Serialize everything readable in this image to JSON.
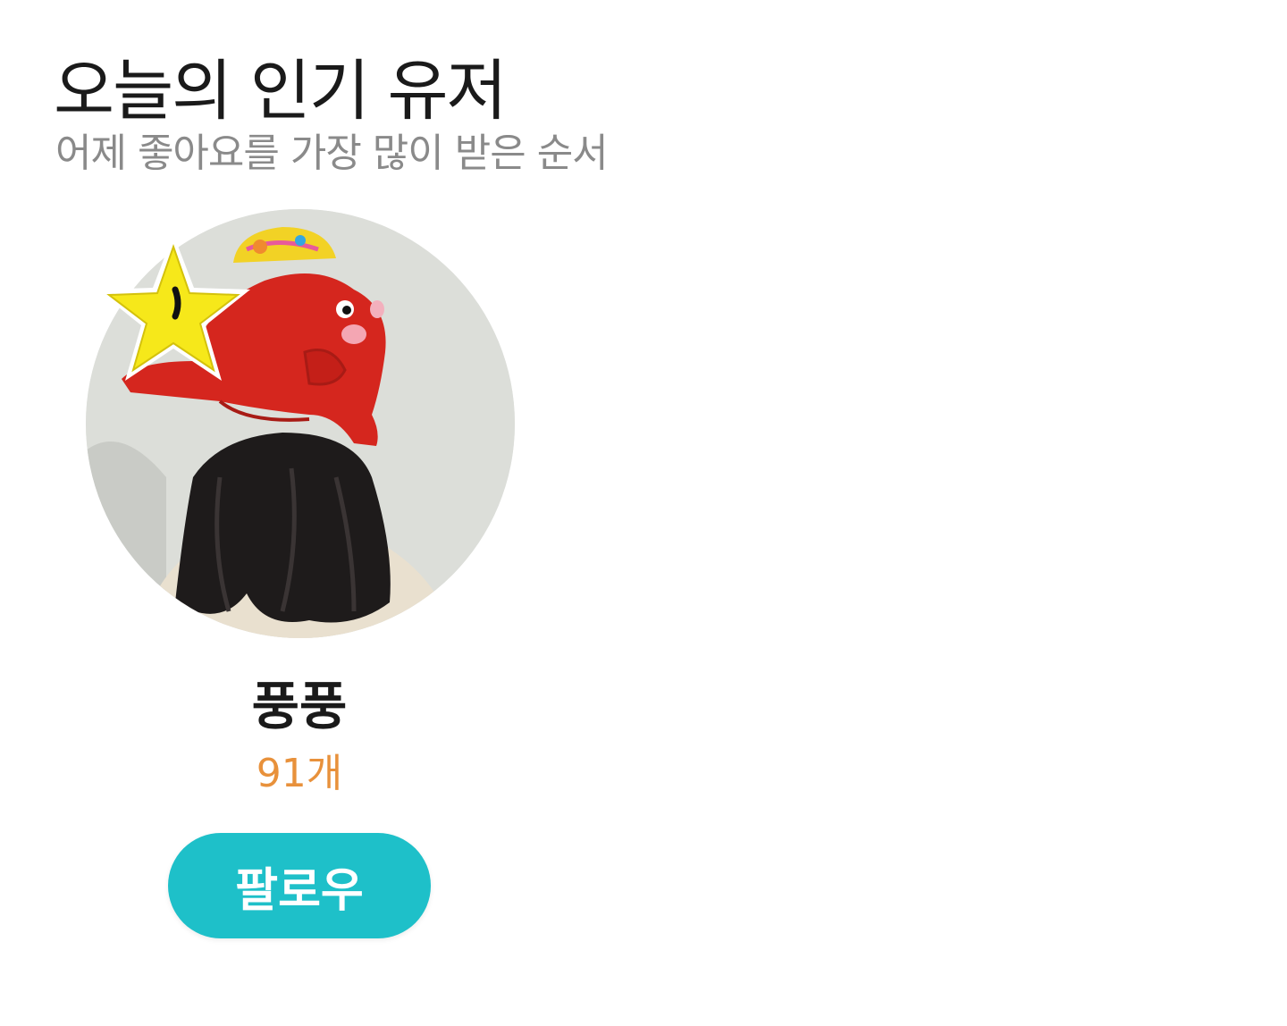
{
  "section": {
    "title": "오늘의 인기 유저",
    "subtitle": "어제 좋아요를 가장 많이 받은 순서"
  },
  "user": {
    "name": "풍풍",
    "like_count": "91개",
    "follow_label": "팔로우",
    "avatar_icon": "profile-photo",
    "badge_icon": "star-icon"
  },
  "colors": {
    "accent": "#1ec0c9",
    "count": "#e8913b",
    "title": "#1a1a1a",
    "subtitle": "#8a8a8a"
  }
}
